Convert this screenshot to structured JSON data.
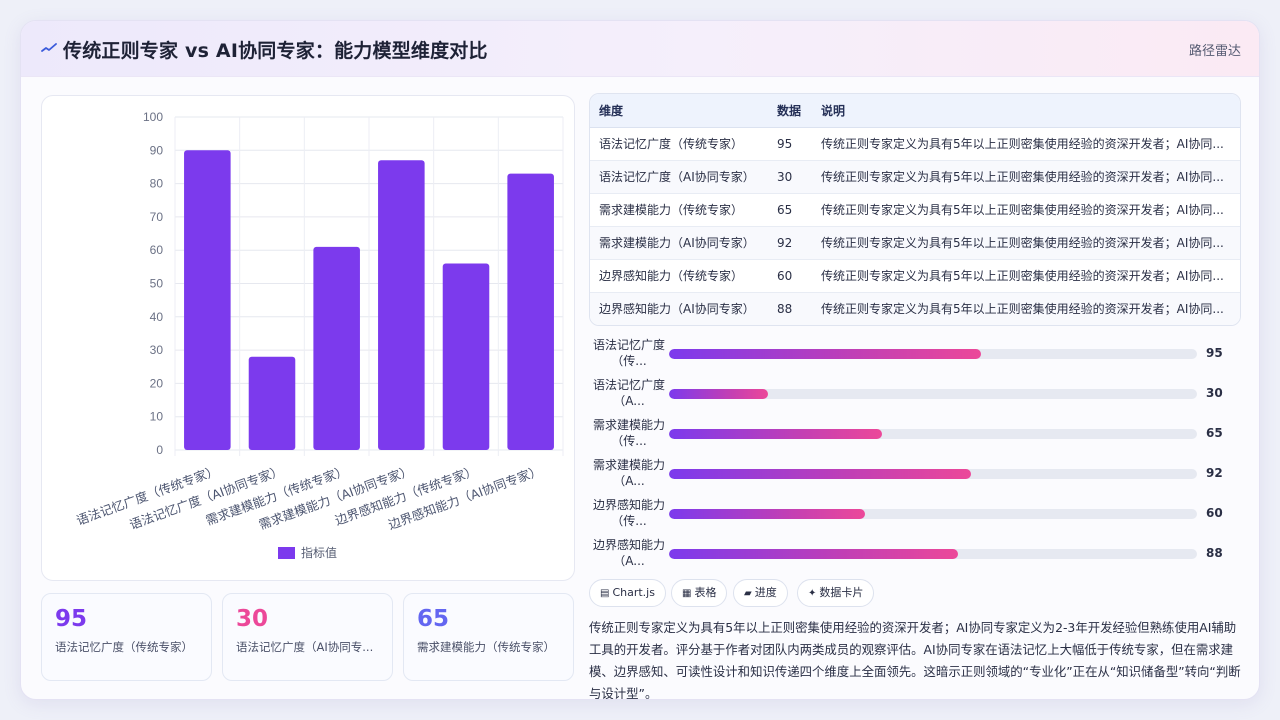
{
  "header": {
    "title": "传统正则专家 vs AI协同专家：能力模型维度对比",
    "route_link": "路径雷达"
  },
  "colors": {
    "bar": "#7c3aed",
    "kpi_values": [
      "#7c3aed",
      "#ec4899",
      "#6366f1"
    ],
    "progress_gradient": [
      "#7c3aed",
      "#ec4899"
    ]
  },
  "chart_data": {
    "type": "bar",
    "categories": [
      "语法记忆广度（传统专家）",
      "语法记忆广度（AI协同专家）",
      "需求建模能力（传统专家）",
      "需求建模能力（AI协同专家）",
      "边界感知能力（传统专家）",
      "边界感知能力（AI协同专家）"
    ],
    "series": [
      {
        "name": "指标值",
        "values": [
          90,
          28,
          61,
          87,
          56,
          83
        ]
      }
    ],
    "ylim": [
      0,
      100
    ],
    "yticks": [
      0,
      10,
      20,
      30,
      40,
      50,
      60,
      70,
      80,
      90,
      100
    ],
    "grid": true,
    "legend": "bottom"
  },
  "table": {
    "headers": [
      "维度",
      "数据",
      "说明"
    ],
    "rows": [
      [
        "语法记忆广度（传统专家）",
        "95",
        "传统正则专家定义为具有5年以上正则密集使用经验的资深开发者；AI协同..."
      ],
      [
        "语法记忆广度（AI协同专家）",
        "30",
        "传统正则专家定义为具有5年以上正则密集使用经验的资深开发者；AI协同..."
      ],
      [
        "需求建模能力（传统专家）",
        "65",
        "传统正则专家定义为具有5年以上正则密集使用经验的资深开发者；AI协同..."
      ],
      [
        "需求建模能力（AI协同专家）",
        "92",
        "传统正则专家定义为具有5年以上正则密集使用经验的资深开发者；AI协同..."
      ],
      [
        "边界感知能力（传统专家）",
        "60",
        "传统正则专家定义为具有5年以上正则密集使用经验的资深开发者；AI协同..."
      ],
      [
        "边界感知能力（AI协同专家）",
        "88",
        "传统正则专家定义为具有5年以上正则密集使用经验的资深开发者；AI协同..."
      ]
    ]
  },
  "progress": [
    {
      "label": "语法记忆广度（传...",
      "value": "95",
      "fraction": 0.59
    },
    {
      "label": "语法记忆广度（A...",
      "value": "30",
      "fraction": 0.187
    },
    {
      "label": "需求建模能力（传...",
      "value": "65",
      "fraction": 0.403
    },
    {
      "label": "需求建模能力（A...",
      "value": "92",
      "fraction": 0.572
    },
    {
      "label": "边界感知能力（传...",
      "value": "60",
      "fraction": 0.372
    },
    {
      "label": "边界感知能力（A...",
      "value": "88",
      "fraction": 0.547
    }
  ],
  "kpis": [
    {
      "value": "95",
      "label": "语法记忆广度（传统专家）"
    },
    {
      "value": "30",
      "label": "语法记忆广度（AI协同专..."
    },
    {
      "value": "65",
      "label": "需求建模能力（传统专家）"
    }
  ],
  "tags": [
    {
      "icon": "chart-icon",
      "glyph": "▤",
      "label": "Chart.js"
    },
    {
      "icon": "table-icon",
      "glyph": "▦",
      "label": "表格"
    },
    {
      "icon": "progress-icon",
      "glyph": "▰",
      "label": "进度"
    },
    {
      "icon": "card-icon",
      "glyph": "✦",
      "label": "数据卡片"
    }
  ],
  "note": "传统正则专家定义为具有5年以上正则密集使用经验的资深开发者；AI协同专家定义为2-3年开发经验但熟练使用AI辅助工具的开发者。评分基于作者对团队内两类成员的观察评估。AI协同专家在语法记忆上大幅低于传统专家，但在需求建模、边界感知、可读性设计和知识传递四个维度上全面领先。这暗示正则领域的“专业化”正在从“知识储备型”转向“判断与设计型”。"
}
